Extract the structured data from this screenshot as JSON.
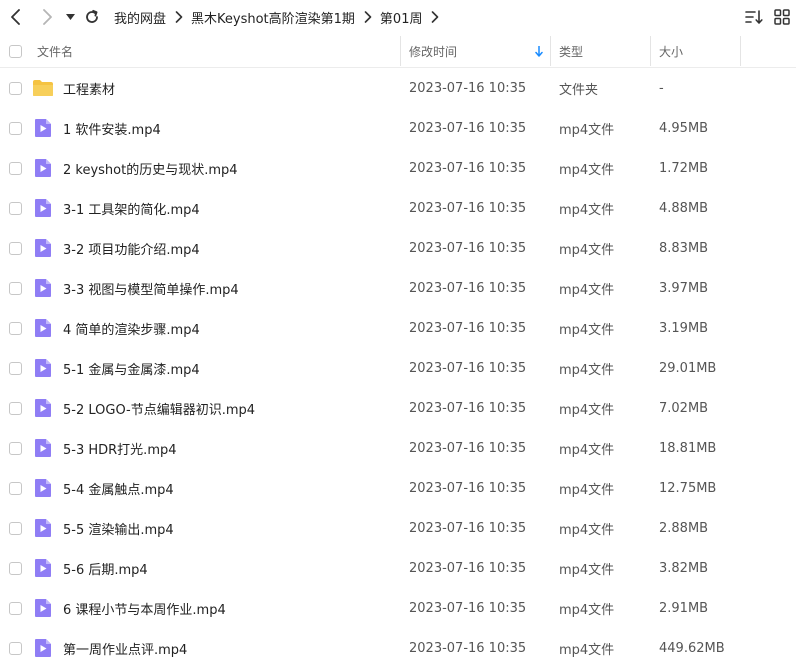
{
  "breadcrumb": {
    "items": [
      "我的网盘",
      "黑木Keyshot高阶渲染第1期",
      "第01周"
    ]
  },
  "columns": {
    "name": "文件名",
    "modified": "修改时间",
    "type": "类型",
    "size": "大小"
  },
  "sort": {
    "column": "modified",
    "direction": "desc"
  },
  "colors": {
    "accent": "#1a8cff",
    "folder": "#f5c342",
    "video": "#8f7df5"
  },
  "files": [
    {
      "kind": "folder",
      "icon": "folder-icon",
      "name": "工程素材",
      "modified": "2023-07-16 10:35",
      "type": "文件夹",
      "size": "-"
    },
    {
      "kind": "video",
      "icon": "video-file-icon",
      "name": "1 软件安装.mp4",
      "modified": "2023-07-16 10:35",
      "type": "mp4文件",
      "size": "4.95MB"
    },
    {
      "kind": "video",
      "icon": "video-file-icon",
      "name": "2 keyshot的历史与现状.mp4",
      "modified": "2023-07-16 10:35",
      "type": "mp4文件",
      "size": "1.72MB"
    },
    {
      "kind": "video",
      "icon": "video-file-icon",
      "name": "3-1 工具架的简化.mp4",
      "modified": "2023-07-16 10:35",
      "type": "mp4文件",
      "size": "4.88MB"
    },
    {
      "kind": "video",
      "icon": "video-file-icon",
      "name": "3-2 项目功能介绍.mp4",
      "modified": "2023-07-16 10:35",
      "type": "mp4文件",
      "size": "8.83MB"
    },
    {
      "kind": "video",
      "icon": "video-file-icon",
      "name": "3-3 视图与模型简单操作.mp4",
      "modified": "2023-07-16 10:35",
      "type": "mp4文件",
      "size": "3.97MB"
    },
    {
      "kind": "video",
      "icon": "video-file-icon",
      "name": "4 简单的渲染步骤.mp4",
      "modified": "2023-07-16 10:35",
      "type": "mp4文件",
      "size": "3.19MB"
    },
    {
      "kind": "video",
      "icon": "video-file-icon",
      "name": "5-1 金属与金属漆.mp4",
      "modified": "2023-07-16 10:35",
      "type": "mp4文件",
      "size": "29.01MB"
    },
    {
      "kind": "video",
      "icon": "video-file-icon",
      "name": "5-2 LOGO-节点编辑器初识.mp4",
      "modified": "2023-07-16 10:35",
      "type": "mp4文件",
      "size": "7.02MB"
    },
    {
      "kind": "video",
      "icon": "video-file-icon",
      "name": "5-3 HDR打光.mp4",
      "modified": "2023-07-16 10:35",
      "type": "mp4文件",
      "size": "18.81MB"
    },
    {
      "kind": "video",
      "icon": "video-file-icon",
      "name": "5-4 金属触点.mp4",
      "modified": "2023-07-16 10:35",
      "type": "mp4文件",
      "size": "12.75MB"
    },
    {
      "kind": "video",
      "icon": "video-file-icon",
      "name": "5-5 渲染输出.mp4",
      "modified": "2023-07-16 10:35",
      "type": "mp4文件",
      "size": "2.88MB"
    },
    {
      "kind": "video",
      "icon": "video-file-icon",
      "name": "5-6 后期.mp4",
      "modified": "2023-07-16 10:35",
      "type": "mp4文件",
      "size": "3.82MB"
    },
    {
      "kind": "video",
      "icon": "video-file-icon",
      "name": "6 课程小节与本周作业.mp4",
      "modified": "2023-07-16 10:35",
      "type": "mp4文件",
      "size": "2.91MB"
    },
    {
      "kind": "video",
      "icon": "video-file-icon",
      "name": "第一周作业点评.mp4",
      "modified": "2023-07-16 10:35",
      "type": "mp4文件",
      "size": "449.62MB"
    }
  ]
}
